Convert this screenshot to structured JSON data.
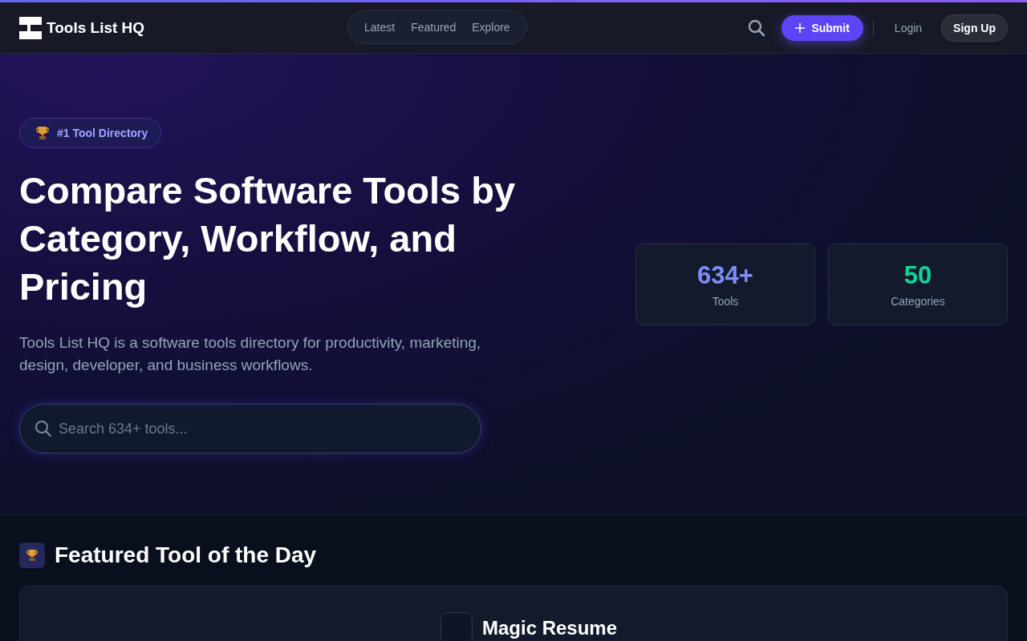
{
  "header": {
    "logo": "Tools List HQ",
    "nav": [
      {
        "label": "Latest"
      },
      {
        "label": "Featured"
      },
      {
        "label": "Explore"
      }
    ],
    "submit": "Submit",
    "login": "Login",
    "signup": "Sign Up"
  },
  "hero": {
    "badge": "#1 Tool Directory",
    "title": "Compare Software Tools by Category, Workflow, and Pricing",
    "subtitle": "Tools List HQ is a software tools directory for productivity, marketing, design, developer, and business workflows.",
    "search": {
      "placeholder": "Search 634+ tools..."
    },
    "stats": [
      {
        "value": "634+",
        "label": "Tools",
        "color": "#818cf8"
      },
      {
        "value": "50",
        "label": "Categories",
        "color": "#10d49a"
      }
    ]
  },
  "featured": {
    "heading": "Featured Tool of the Day",
    "tool": {
      "name": "Magic Resume"
    }
  }
}
